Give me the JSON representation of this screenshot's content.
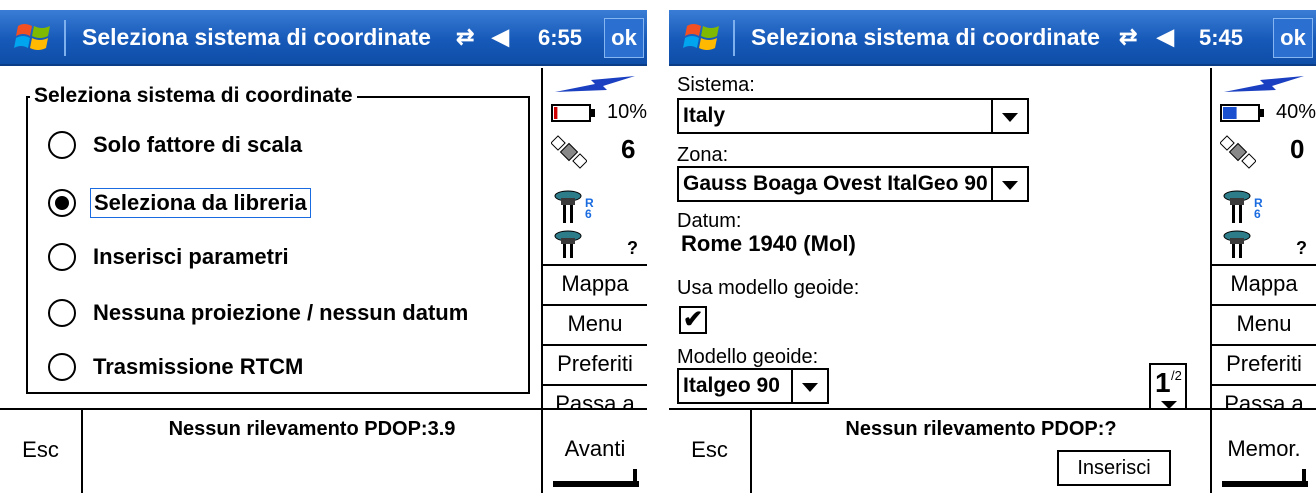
{
  "left": {
    "titlebar": {
      "title": "Seleziona sistema di coordinate",
      "connectivity_icon": "⇄",
      "volume_icon": "◀",
      "time": "6:55",
      "ok_label": "ok"
    },
    "group_title": "Seleziona sistema di coordinate",
    "options": [
      {
        "label": "Solo fattore di scala",
        "selected": false
      },
      {
        "label": "Seleziona da libreria",
        "selected": true
      },
      {
        "label": "Inserisci parametri",
        "selected": false
      },
      {
        "label": "Nessuna proiezione / nessun datum",
        "selected": false
      },
      {
        "label": "Trasmissione RTCM",
        "selected": false
      }
    ],
    "status": {
      "battery_pct": "10%",
      "battery_level": 0.1,
      "battery_color": "#d00000",
      "satellites": "6",
      "rover_sub": "R\n6",
      "rover2_q": ""
    },
    "side_buttons": {
      "mappa": "Mappa",
      "menu": "Menu",
      "preferiti": "Preferiti",
      "passa_a": "Passa a"
    },
    "bottom": {
      "esc": "Esc",
      "status_text": "Nessun rilevamento  PDOP:3.9",
      "right_softkey": "Avanti"
    }
  },
  "right": {
    "titlebar": {
      "title": "Seleziona sistema di coordinate",
      "connectivity_icon": "⇄",
      "volume_icon": "◀",
      "time": "5:45",
      "ok_label": "ok"
    },
    "sistema_label": "Sistema:",
    "sistema_value": "Italy",
    "zona_label": "Zona:",
    "zona_value": "Gauss Boaga Ovest ItalGeo 90",
    "datum_label": "Datum:",
    "datum_value": "Rome 1940 (Mol)",
    "geoid_use_label": "Usa modello geoide:",
    "geoid_use_checked": "✔",
    "geoid_model_label": "Modello geoide:",
    "geoid_model_value": "Italgeo 90",
    "pager": {
      "current": "1",
      "total": "/2"
    },
    "status": {
      "battery_pct": "40%",
      "battery_level": 0.4,
      "battery_color": "#1a4fd0",
      "satellites": "0",
      "rover_sub": "R\n6",
      "rover2_q": "?"
    },
    "side_buttons": {
      "mappa": "Mappa",
      "menu": "Menu",
      "preferiti": "Preferiti",
      "passa_a": "Passa a"
    },
    "bottom": {
      "esc": "Esc",
      "status_text": "Nessun rilevamento  PDOP:?",
      "inserisci": "Inserisci",
      "right_softkey": "Memor."
    }
  },
  "left_rover2_q": "?",
  "colors": {
    "titlebar": "#1659b8",
    "focus": "#1a6be0"
  }
}
